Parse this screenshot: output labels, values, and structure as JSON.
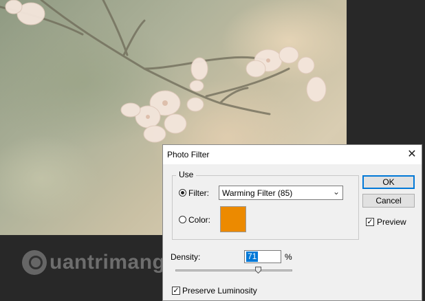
{
  "dialog": {
    "title": "Photo Filter",
    "use_label": "Use",
    "filter_label": "Filter:",
    "filter_value": "Warming Filter (85)",
    "color_label": "Color:",
    "color_swatch": "#ec8a00",
    "ok_label": "OK",
    "cancel_label": "Cancel",
    "preview_label": "Preview",
    "preview_checked": true,
    "density_label": "Density:",
    "density_value": "71",
    "density_unit": "%",
    "density_slider_value": 71,
    "preserve_label": "Preserve Luminosity",
    "preserve_checked": true
  },
  "watermark": {
    "text": "uantrimang"
  },
  "icons": {
    "close": "close-icon",
    "check": "checkmark-icon",
    "dropdown": "chevron-down-icon",
    "slider": "slider-thumb-icon"
  }
}
